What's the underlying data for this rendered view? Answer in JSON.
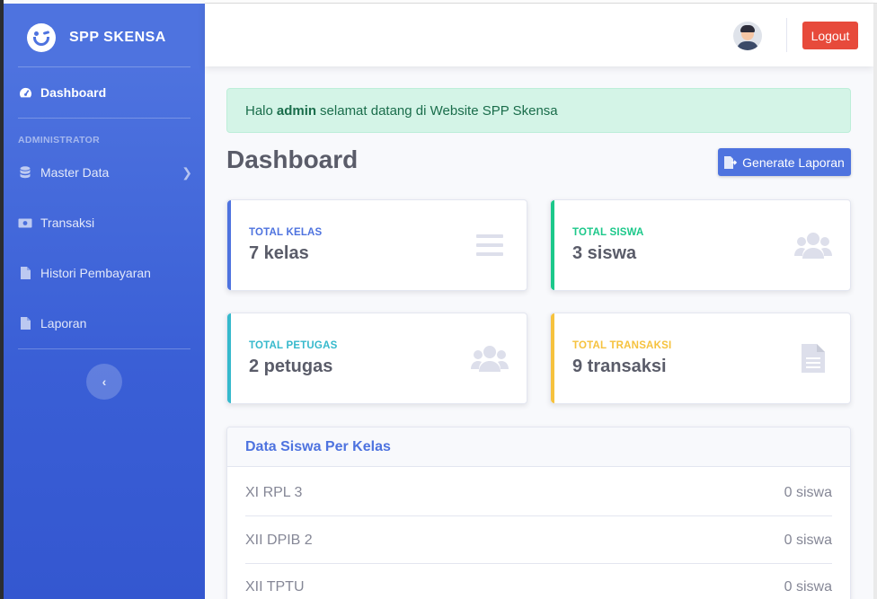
{
  "brand": {
    "name": "SPP SKENSA",
    "logo_icon": "laughing-face-icon"
  },
  "sidebar": {
    "dashboard": {
      "label": "Dashboard",
      "icon": "tachometer-icon"
    },
    "heading": "ADMINISTRATOR",
    "items": [
      {
        "label": "Master Data",
        "icon": "database-icon",
        "has_submenu": true
      },
      {
        "label": "Transaksi",
        "icon": "money-bill-icon"
      },
      {
        "label": "Histori Pembayaran",
        "icon": "file-icon"
      },
      {
        "label": "Laporan",
        "icon": "file-icon"
      }
    ],
    "toggle_icon": "chevron-left-icon"
  },
  "topbar": {
    "logout_label": "Logout",
    "avatar_icon": "user-avatar-icon"
  },
  "alert": {
    "prefix": "Halo",
    "user": "admin",
    "suffix": "selamat datang di Website SPP Skensa"
  },
  "page": {
    "title": "Dashboard",
    "generate_label": "Generate Laporan"
  },
  "cards": [
    {
      "label": "TOTAL KELAS",
      "value": "7 kelas",
      "color": "#4e73df",
      "icon": "bars-icon"
    },
    {
      "label": "TOTAL SISWA",
      "value": "3 siswa",
      "color": "#1cc88a",
      "icon": "users-icon"
    },
    {
      "label": "TOTAL PETUGAS",
      "value": "2 petugas",
      "color": "#36b9cc",
      "icon": "users-icon"
    },
    {
      "label": "TOTAL TRANSAKSI",
      "value": "9 transaksi",
      "color": "#f6c23e",
      "icon": "file-alt-icon"
    }
  ],
  "panel": {
    "title": "Data Siswa Per Kelas",
    "rows": [
      {
        "kelas": "XI RPL 3",
        "count": "0 siswa"
      },
      {
        "kelas": "XII DPIB 2",
        "count": "0 siswa"
      },
      {
        "kelas": "XII TPTU",
        "count": "0 siswa"
      }
    ]
  },
  "colors": {
    "primary": "#4e73df",
    "danger": "#e74a3b",
    "success": "#1cc88a",
    "info": "#36b9cc",
    "warning": "#f6c23e"
  }
}
